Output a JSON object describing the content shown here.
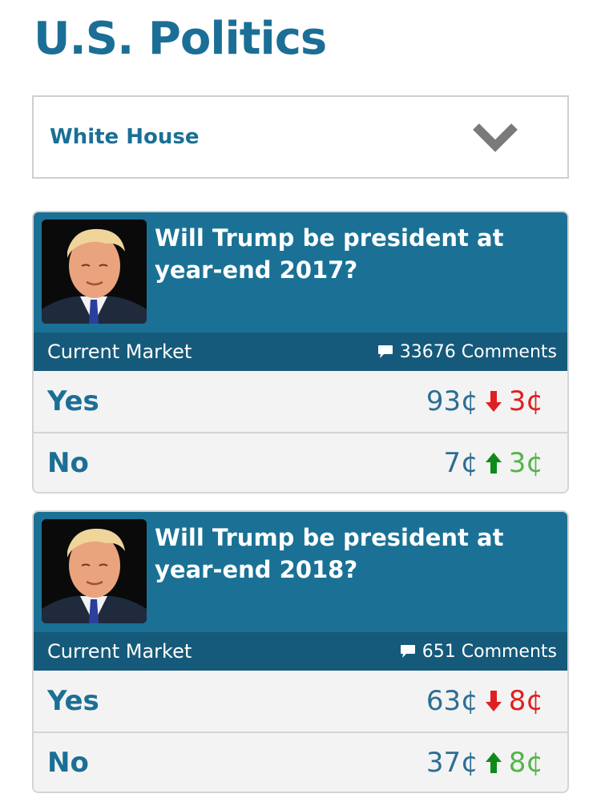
{
  "page": {
    "title": "U.S. Politics"
  },
  "category_dropdown": {
    "selected": "White House",
    "icon": "chevron-down-icon"
  },
  "colors": {
    "brand": "#1b6f96",
    "card_header": "#1a7195",
    "market_bar": "#155a7a",
    "down": "#e02020",
    "up": "#55b44a",
    "up_arrow": "#0f8a1a"
  },
  "markets": [
    {
      "question": "Will Trump be president at year-end 2017?",
      "market_label": "Current Market",
      "comments": "33676 Comments",
      "outcomes": [
        {
          "name": "Yes",
          "price": "93¢",
          "direction": "down",
          "change": "3¢"
        },
        {
          "name": "No",
          "price": "7¢",
          "direction": "up",
          "change": "3¢"
        }
      ]
    },
    {
      "question": "Will Trump be president at year-end 2018?",
      "market_label": "Current Market",
      "comments": "651 Comments",
      "outcomes": [
        {
          "name": "Yes",
          "price": "63¢",
          "direction": "down",
          "change": "8¢"
        },
        {
          "name": "No",
          "price": "37¢",
          "direction": "up",
          "change": "8¢"
        }
      ]
    }
  ]
}
